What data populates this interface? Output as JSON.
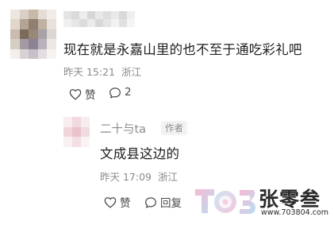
{
  "comments": [
    {
      "username": "",
      "text": "现在就是永嘉山里的也不至于通吃彩礼吧",
      "time": "昨天 15:21",
      "location": "浙江",
      "like_label": "赞",
      "reply_count": "2"
    },
    {
      "username": "二十与ta",
      "badge": "作者",
      "text": "文成县这边的",
      "time": "昨天 17:09",
      "location": "浙江",
      "like_label": "赞",
      "reply_label": "回复"
    }
  ],
  "watermark": {
    "name": "张零叁",
    "url": "www.703804.com"
  },
  "icons": {
    "like": "heart-outline-icon",
    "comment": "speech-bubble-icon"
  },
  "colors": {
    "text_primary": "#202020",
    "text_secondary": "#8a8a8a",
    "action_text": "#4a4a4a",
    "badge_background": "#f2f2f2"
  }
}
